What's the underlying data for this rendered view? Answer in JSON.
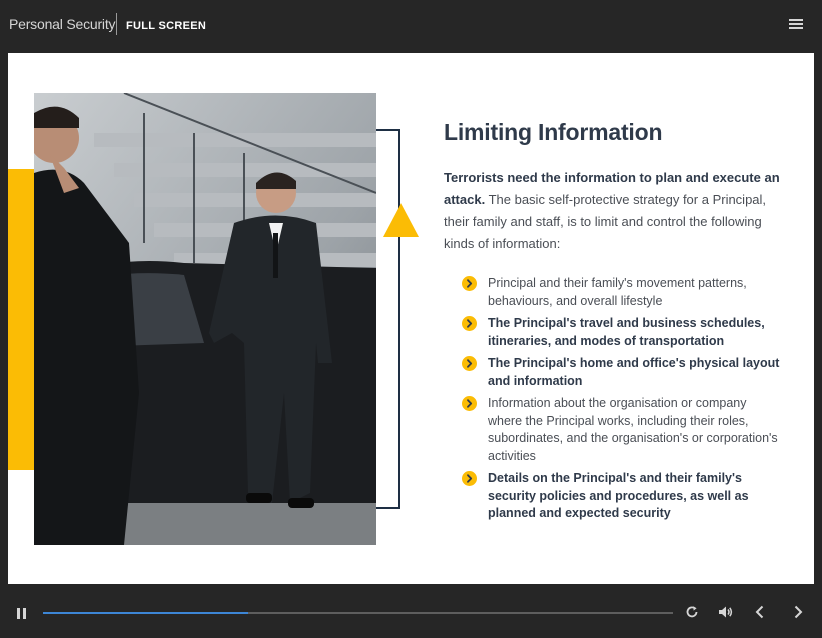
{
  "header": {
    "app_title": "Personal Security",
    "fullscreen_label": "FULL SCREEN"
  },
  "slide": {
    "heading": "Limiting Information",
    "intro_bold": "Terrorists need the information to plan and execute an attack.",
    "intro_rest": " The basic self-protective strategy for a Principal, their family and staff, is to limit and control the following kinds of information:",
    "bullets": [
      {
        "text": "Principal and their family's movement patterns, behaviours, and overall lifestyle",
        "bold": false
      },
      {
        "text": "The Principal's travel and business schedules, itineraries, and modes of transportation",
        "bold": true
      },
      {
        "text": "The Principal's home and office's physical layout and information",
        "bold": true
      },
      {
        "text": "Information about the organisation or company where the Principal works, including their roles, subordinates, and the organisation's or corporation's activities",
        "bold": false
      },
      {
        "text": "Details on the Principal's and their family's security policies and procedures, as well as planned and expected security",
        "bold": true
      }
    ],
    "accent_color": "#fbbc05",
    "bracket_color": "#1e2f44"
  },
  "player": {
    "progress": 0.325,
    "progress_color": "#3d86d6",
    "icons": [
      "pause-icon",
      "replay-icon",
      "volume-icon",
      "prev-icon",
      "next-icon"
    ]
  }
}
